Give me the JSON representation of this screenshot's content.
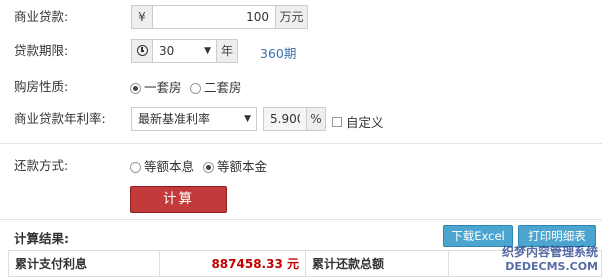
{
  "loan_amount": {
    "label": "商业贷款:",
    "currency_symbol": "¥",
    "value": "100",
    "unit": "万元"
  },
  "loan_term": {
    "label": "贷款期限:",
    "icon": "clock-icon",
    "selected": "30",
    "unit": "年",
    "months_text": "360期"
  },
  "property_type": {
    "label": "购房性质:",
    "options": [
      {
        "label": "一套房",
        "checked": true
      },
      {
        "label": "二套房",
        "checked": false
      }
    ]
  },
  "interest_rate": {
    "label": "商业贷款年利率:",
    "selected": "最新基准利率",
    "value": "5.900",
    "unit": "%",
    "custom_label": "自定义",
    "custom_checked": false
  },
  "repayment": {
    "label": "还款方式:",
    "options": [
      {
        "label": "等额本息",
        "checked": false
      },
      {
        "label": "等额本金",
        "checked": true
      }
    ]
  },
  "calculate_button": "计算",
  "results": {
    "title": "计算结果:",
    "download_excel": "下载Excel",
    "print_schedule": "打印明细表",
    "total_interest_label": "累计支付利息",
    "total_interest_value": "887458.33 元",
    "total_repayment_label": "累计还款总额",
    "total_repayment_value": ""
  },
  "watermark": {
    "line1": "织梦内容管理系统",
    "line2": "DEDECMS.COM"
  },
  "colors": {
    "calc_button": "#c33a3a",
    "blue_button": "#4ba5cf",
    "result_value": "#c00000",
    "link_blue": "#3a6fb0"
  }
}
